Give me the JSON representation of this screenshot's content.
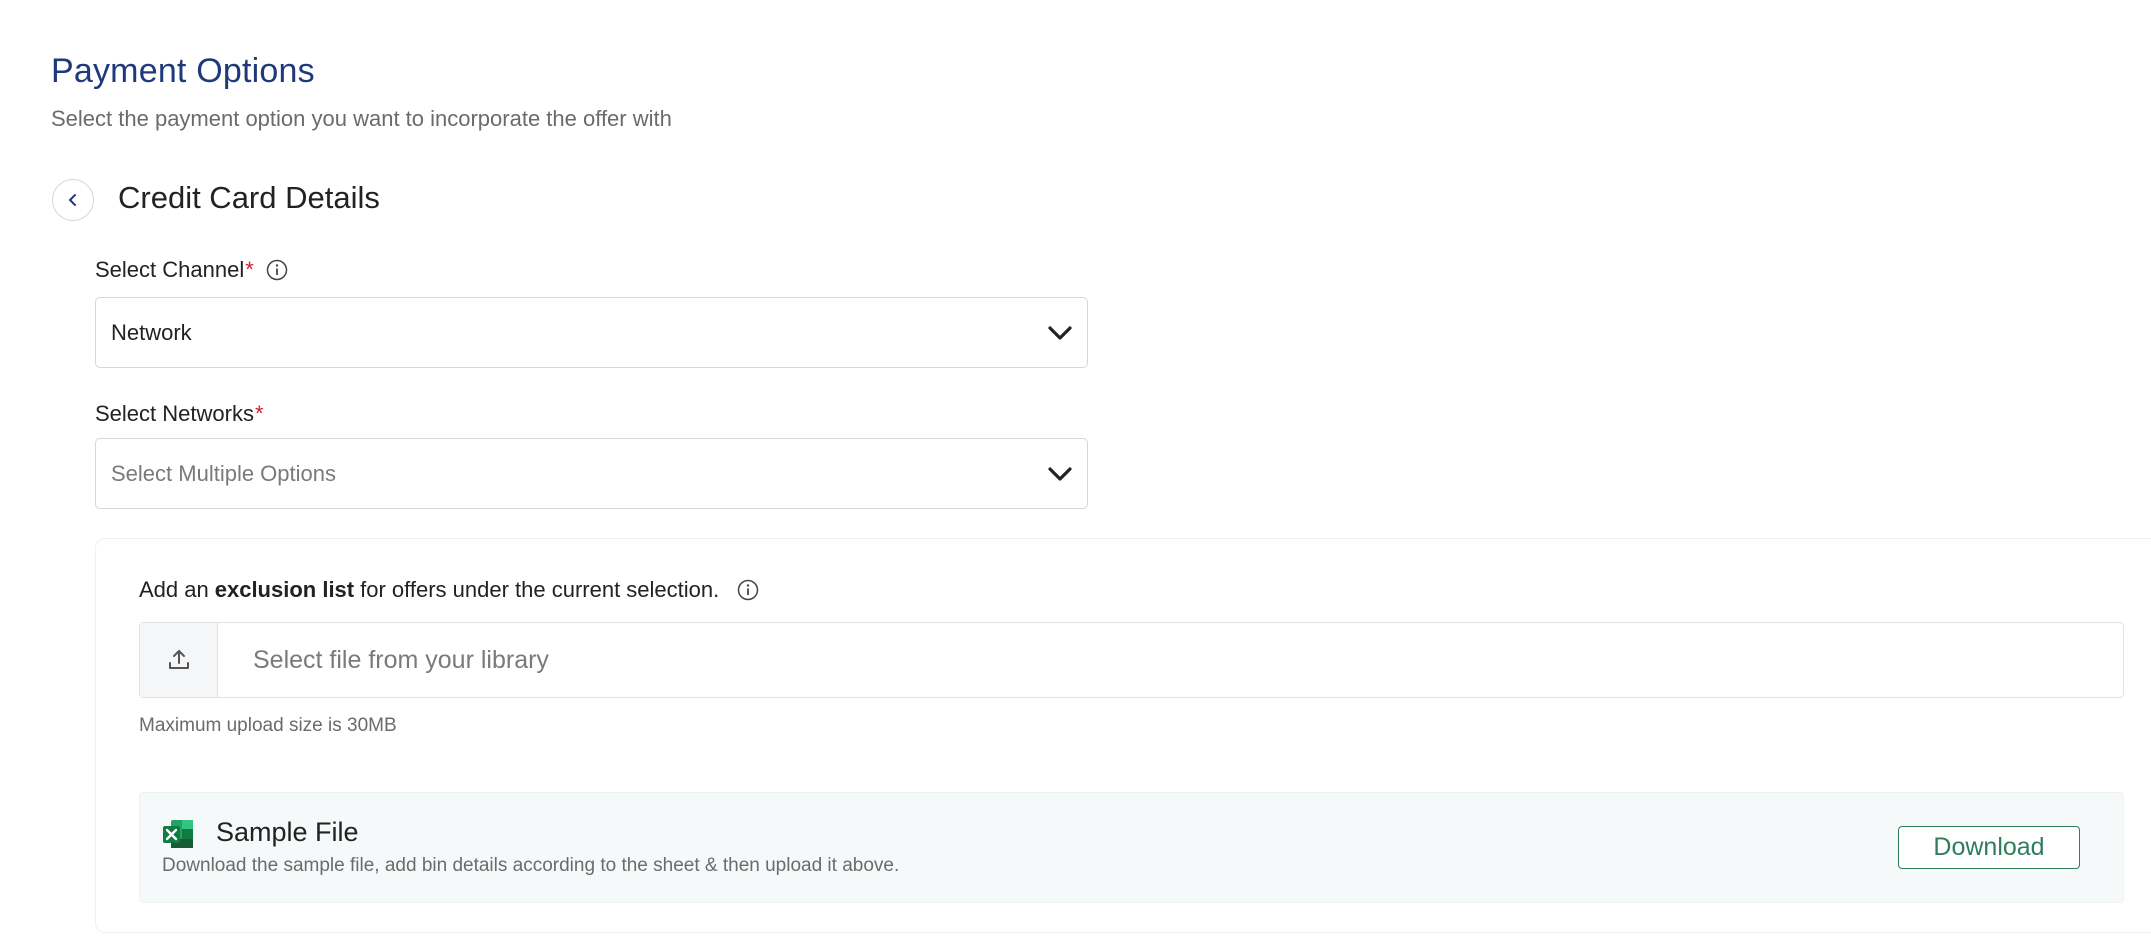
{
  "header": {
    "title": "Payment Options",
    "subtitle": "Select the payment option you want to incorporate the offer with"
  },
  "section": {
    "title": "Credit Card Details"
  },
  "channel_field": {
    "label": "Select Channel",
    "required_mark": "*",
    "value": "Network"
  },
  "networks_field": {
    "label": "Select Networks",
    "required_mark": "*",
    "placeholder": "Select Multiple Options"
  },
  "exclusion": {
    "text_before": "Add an",
    "text_bold": "exclusion list",
    "text_after": "for offers under the current selection.",
    "upload_placeholder": "Select file from your library",
    "upload_hint": "Maximum upload size is 30MB"
  },
  "sample": {
    "title": "Sample File",
    "description": "Download the sample file, add bin details according to the sheet & then upload it above.",
    "download_label": "Download"
  },
  "colors": {
    "title_blue": "#1f3a7a",
    "required_red": "#d0202a",
    "download_green": "#2e7d5b",
    "excel_green": "#1d8348"
  },
  "icons": {
    "back": "chevron-left-icon",
    "info": "info-icon",
    "dropdown": "chevron-down-icon",
    "upload": "upload-icon",
    "excel": "excel-file-icon"
  }
}
